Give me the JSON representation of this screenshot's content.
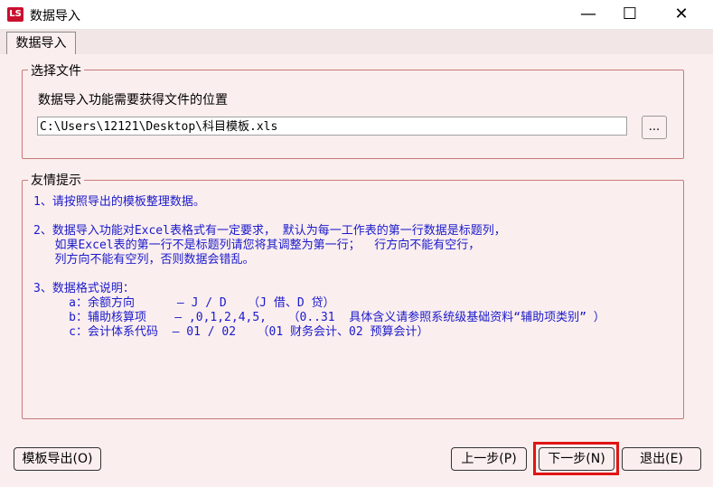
{
  "window": {
    "title": "数据导入",
    "icon_text": "LS",
    "minimize": "—",
    "maximize": "☐",
    "close": "✕"
  },
  "tabs": [
    "数据导入"
  ],
  "file_group": {
    "legend": "选择文件",
    "prompt": "数据导入功能需要获得文件的位置",
    "path_value": "C:\\Users\\12121\\Desktop\\科目模板.xls",
    "browse_label": "..."
  },
  "tips_group": {
    "legend": "友情提示",
    "lines": [
      "1、请按照导出的模板整理数据。",
      "",
      "2、数据导入功能对Excel表格式有一定要求， 默认为每一工作表的第一行数据是标题列，",
      "   如果Excel表的第一行不是标题列请您将其调整为第一行；  行方向不能有空行，",
      "   列方向不能有空列，否则数据会错乱。",
      "",
      "3、数据格式说明：",
      "     a：余额方向      — J / D   （J 借、D 贷）",
      "     b：辅助核算项    — ,0,1,2,4,5,   （0..31  具体含义请参照系统级基础资料“辅助项类别” ）",
      "     c：会计体系代码  — 01 / 02   （01 财务会计、02 预算会计）"
    ]
  },
  "buttons": {
    "export_template": "模板导出(O)",
    "prev": "上一步(P)",
    "next": "下一步(N)",
    "exit": "退出(E)"
  },
  "colors": {
    "background": "#fbeeee",
    "group_border": "#c77a7a",
    "tip_text": "#1a1acc",
    "highlight": "#e01515"
  }
}
